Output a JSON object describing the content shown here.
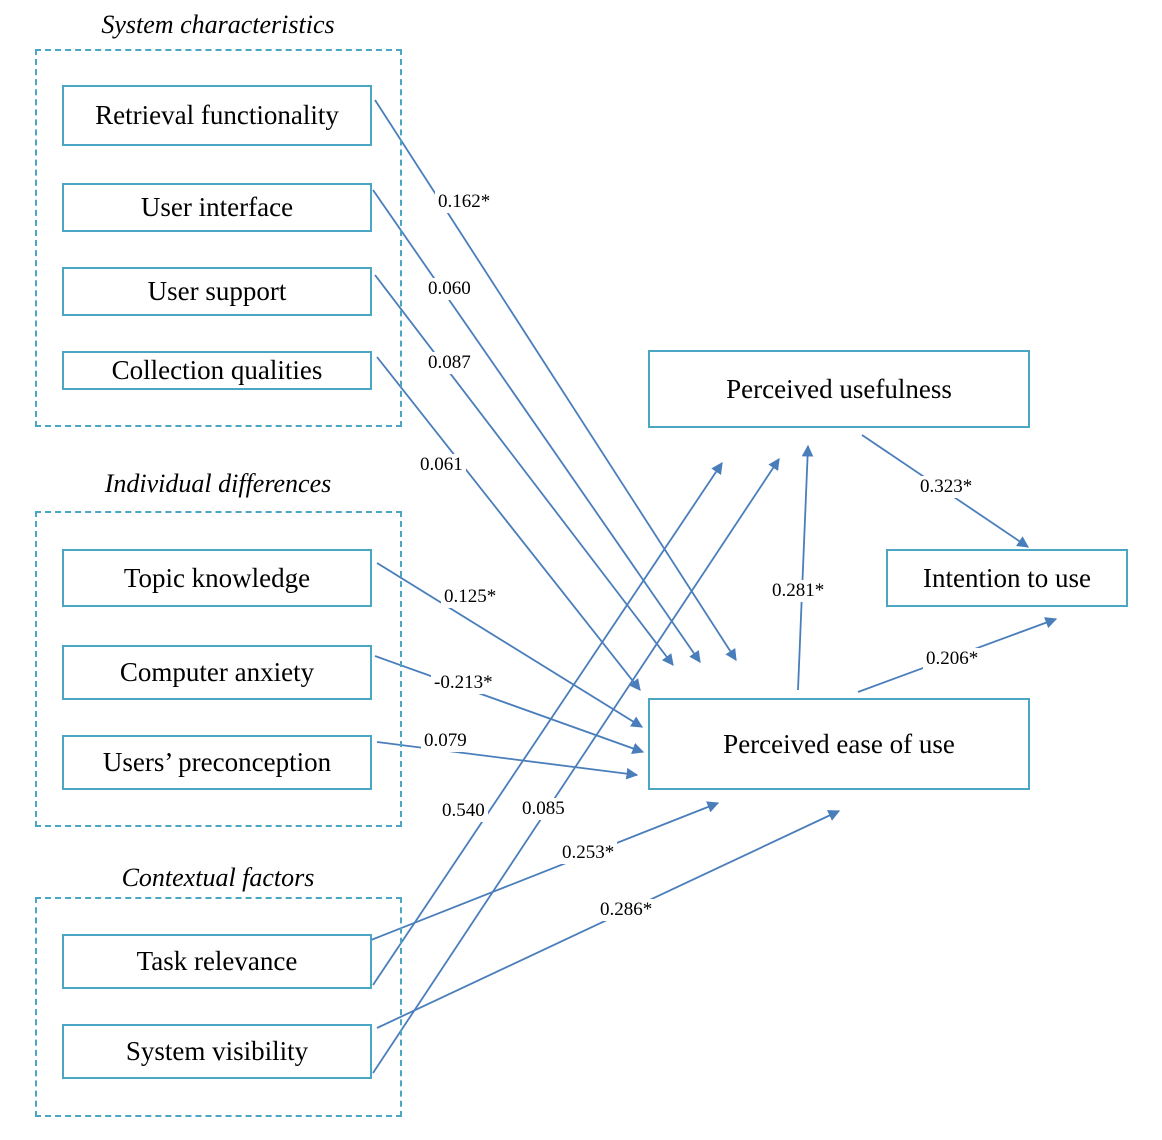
{
  "groups": {
    "system": {
      "title": "System characteristics"
    },
    "individual": {
      "title": "Individual differences"
    },
    "contextual": {
      "title": "Contextual factors"
    }
  },
  "nodes": {
    "retrieval": "Retrieval functionality",
    "interface": "User interface",
    "support": "User support",
    "collection": "Collection qualities",
    "topic": "Topic knowledge",
    "anxiety": "Computer anxiety",
    "preconception": "Users’ preconception",
    "task": "Task relevance",
    "visibility": "System visibility",
    "pu": "Perceived usefulness",
    "peou": "Perceived ease of use",
    "intention": "Intention to use"
  },
  "paths": [
    {
      "from": "Retrieval functionality",
      "to": "Perceived ease of use",
      "coef": "0.162*"
    },
    {
      "from": "User interface",
      "to": "Perceived ease of use",
      "coef": "0.060"
    },
    {
      "from": "User support",
      "to": "Perceived ease of use",
      "coef": "0.087"
    },
    {
      "from": "Collection qualities",
      "to": "Perceived ease of use",
      "coef": "0.061"
    },
    {
      "from": "Topic knowledge",
      "to": "Perceived ease of use",
      "coef": "0.125*"
    },
    {
      "from": "Computer anxiety",
      "to": "Perceived ease of use",
      "coef": "-0.213*"
    },
    {
      "from": "Users’ preconception",
      "to": "Perceived ease of use",
      "coef": "0.079"
    },
    {
      "from": "Task relevance",
      "to": "Perceived usefulness",
      "coef": "0.540"
    },
    {
      "from": "System visibility",
      "to": "Perceived usefulness",
      "coef": "0.085"
    },
    {
      "from": "Task relevance",
      "to": "Perceived ease of use",
      "coef": "0.253*"
    },
    {
      "from": "System visibility",
      "to": "Perceived ease of use",
      "coef": "0.286*"
    },
    {
      "from": "Perceived ease of use",
      "to": "Perceived usefulness",
      "coef": "0.281*"
    },
    {
      "from": "Perceived usefulness",
      "to": "Intention to use",
      "coef": "0.323*"
    },
    {
      "from": "Perceived ease of use",
      "to": "Intention to use",
      "coef": "0.206*"
    }
  ],
  "colors": {
    "box_border": "#4aa6c2",
    "arrow": "#4a7ebb"
  }
}
